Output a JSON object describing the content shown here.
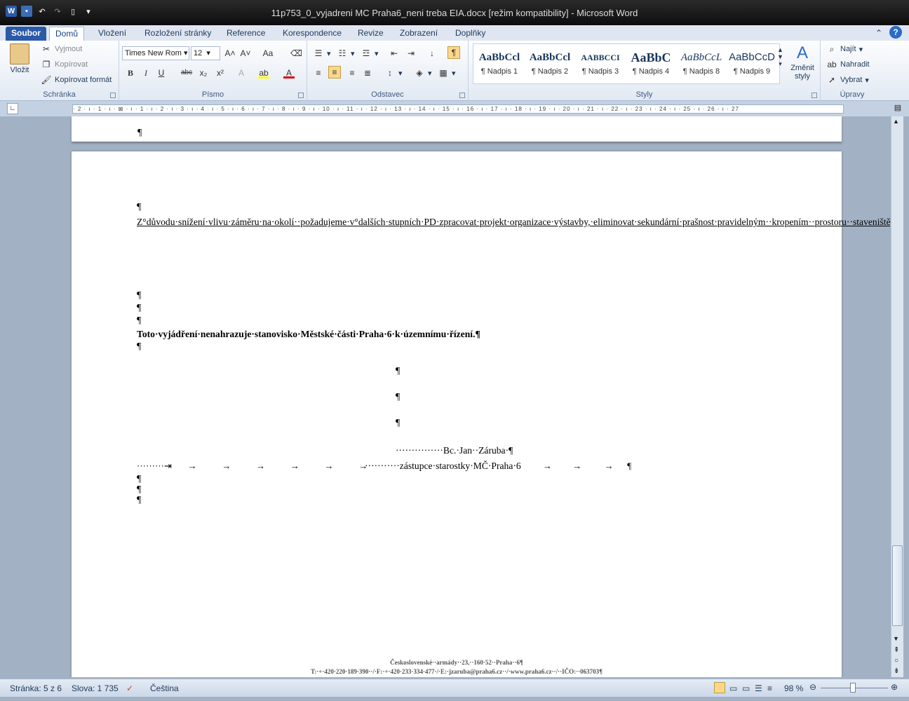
{
  "window": {
    "title": "11p753_0_vyjadreni MC Praha6_neni treba EIA.docx [režim kompatibility]  -  Microsoft Word"
  },
  "tabs": [
    "Soubor",
    "Domů",
    "Vložení",
    "Rozložení stránky",
    "Reference",
    "Korespondence",
    "Revize",
    "Zobrazení",
    "Doplňky"
  ],
  "ribbon": {
    "clipboard": {
      "label": "Schránka",
      "paste": "Vložit",
      "cut": "Vyjmout",
      "copy": "Kopírovat",
      "format_painter": "Kopírovat formát"
    },
    "font": {
      "label": "Písmo",
      "font_name": "Times New Rom",
      "font_size": "12"
    },
    "paragraph": {
      "label": "Odstavec"
    },
    "styles": {
      "label": "Styly",
      "items": [
        {
          "sample": "AaBbCcl",
          "name": "¶ Nadpis 1"
        },
        {
          "sample": "AaBbCcl",
          "name": "¶ Nadpis 2"
        },
        {
          "sample": "AABBCCI",
          "name": "¶ Nadpis 3"
        },
        {
          "sample": "AaBbC",
          "name": "¶ Nadpis 4"
        },
        {
          "sample": "AaBbCcL",
          "name": "¶ Nadpis 8"
        },
        {
          "sample": "AaBbCcD",
          "name": "¶ Nadpis 9"
        }
      ],
      "change_styles": "Změnit styly"
    },
    "editing": {
      "label": "Úpravy",
      "find": "Najít",
      "replace": "Nahradit",
      "select": "Vybrat"
    }
  },
  "ruler": "· 2 · ı · 1 · ı · ⊠ · ı · 1 · ı · 2 · ı · 3 · ı · 4 · ı · 5 · ı · 6 · ı · 7 · ı · 8 · ı · 9 · ı · 10 · ı · 11 · ı · 12 · ı · 13 · ı · 14 · ı · 15 · ı · 16 · ı · 17 · ı · 18 · ı · 19 · ı · 20 · ı · 21 · ı · 22 · ı · 23 · ı · 24 · ı · 25 · ı · 26 · ı · 27",
  "document": {
    "main_paragraph": "Z°důvodu·snížení·vlivu·záměru·na·okolí··požadujeme·v°dalších·stupních·PD·zpracovat·projekt·organizace·výstavby,·eliminovat·sekundární·prašnost·pravidelným··kropením··prostoru··staveniště,··zabezpečit··využívání··veškerých··stavebních··strojů··výhradně··v··denní··době.···Přebytečný··materiál··ze·stavební·činnosti·bude·ihned·odvážen·a·likvidován.·Sypké·odpady·ze·stavby·budou·odváženy·na·zaplachtovaných·korbách·nákladních·automobilů.·Trasy··staveništní··dopravy··budou·před·zahájením·stavby·projednány·se·silničním·správním·úřadem.··Po·celou·dobu·stavby·investor·zajistí·důkladné·čištění·a·úklid·všech·komunikací·(chodníků·a·vozovek)·dotčených·stavbou,·u·výjezdu·ze·staveniště·na·veřejné·komunikace·budou·zřízeny·oklepové·a·mycí·rampy·a·bude·v°případě·potřeby·zajištěno·odstraňování·bláta·z°pneumatik·a·podběhů.··¶",
    "bold_statement": "Toto·vyjádření·nenahrazuje·stanovisko·Městské·části·Praha·6·k·územnímu·řízení.¶",
    "signature_name": "···············Bc.·Jan··Záruba·¶",
    "signature_title": "···········zástupce·starostky·MČ·Praha·6",
    "footer_line1": "Československé··armády··23,··160·52··Praha··6¶",
    "footer_line2": "T:·+·420·220·189·390··/·F:·+·420·233·334·477·/·E:·jzaruba@praha6.cz··/·www.praha6.cz··/··IČO:··063703¶"
  },
  "status": {
    "page": "Stránka: 5 z 6",
    "words": "Slova: 1 735",
    "language": "Čeština",
    "zoom": "98 %"
  }
}
